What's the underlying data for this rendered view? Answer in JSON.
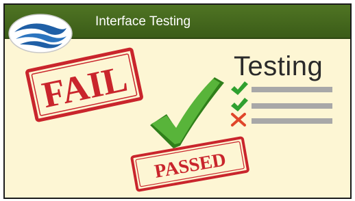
{
  "header": {
    "title": "Interface Testing",
    "color": "#4a6e22"
  },
  "stamps": {
    "fail": {
      "text": "FAIL",
      "color": "#c9252c"
    },
    "passed": {
      "text": "PASSED",
      "color": "#c9252c"
    }
  },
  "checklist": {
    "title": "Testing",
    "items": [
      {
        "status": "pass",
        "icon": "check-icon",
        "color": "#2fa02f"
      },
      {
        "status": "pass",
        "icon": "check-icon",
        "color": "#2fa02f"
      },
      {
        "status": "fail",
        "icon": "cross-icon",
        "color": "#e0462a"
      }
    ],
    "bar_color": "#a8a8a8"
  },
  "big_check": {
    "icon": "check-icon",
    "color": "#3f8f1f"
  },
  "logo": {
    "icon": "waves-logo",
    "color": "#1f5fa6"
  }
}
